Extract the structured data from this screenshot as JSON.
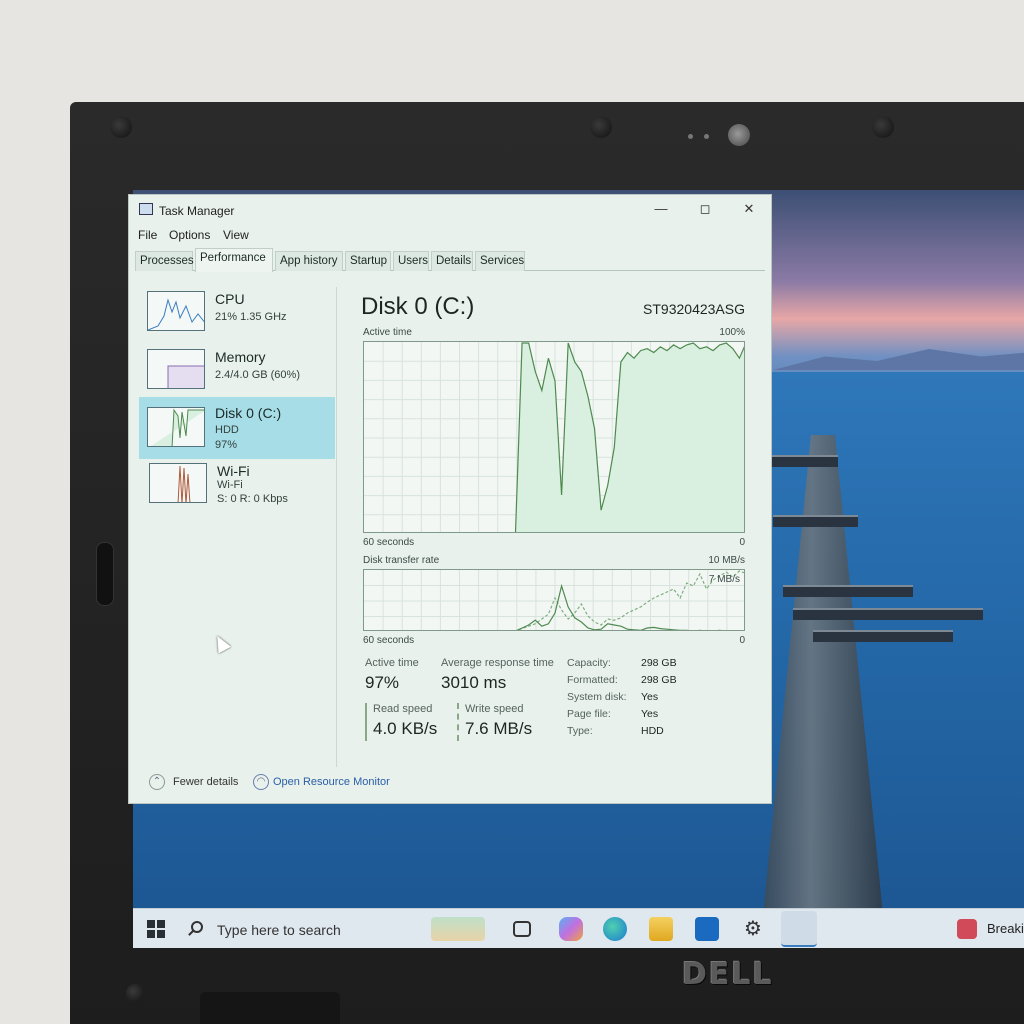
{
  "window": {
    "title": "Task Manager"
  },
  "menu": [
    "File",
    "Options",
    "View"
  ],
  "tabs": [
    "Processes",
    "Performance",
    "App history",
    "Startup",
    "Users",
    "Details",
    "Services"
  ],
  "active_tab": "Performance",
  "sidebar": [
    {
      "name": "CPU",
      "line1": "21%  1.35 GHz",
      "line2": ""
    },
    {
      "name": "Memory",
      "line1": "2.4/4.0 GB (60%)",
      "line2": ""
    },
    {
      "name": "Disk 0 (C:)",
      "line1": "HDD",
      "line2": "97%"
    },
    {
      "name": "Wi-Fi",
      "line1": "Wi-Fi",
      "line2": "S: 0  R: 0 Kbps"
    }
  ],
  "disk": {
    "title": "Disk 0 (C:)",
    "model": "ST9320423ASG",
    "active_label": "Active time",
    "active_max": "100%",
    "axis_left": "60 seconds",
    "axis_right": "0",
    "transfer_label": "Disk transfer rate",
    "transfer_max": "10 MB/s",
    "transfer_mid": "7 MB/s",
    "axis2_left": "60 seconds",
    "axis2_right": "0",
    "active_time_series": [
      0,
      0,
      0,
      0,
      0,
      0,
      0,
      0,
      0,
      0,
      0,
      0,
      0,
      0,
      0,
      0,
      0,
      0,
      0,
      0,
      0,
      0,
      0,
      0,
      100,
      100,
      85,
      75,
      92,
      80,
      20,
      100,
      90,
      85,
      72,
      55,
      12,
      25,
      45,
      90,
      95,
      92,
      96,
      97,
      95,
      98,
      96,
      99,
      97,
      99,
      100,
      97,
      98,
      96,
      99,
      100,
      97,
      92,
      100
    ],
    "transfer_series_read": [
      0,
      0,
      0,
      0,
      0,
      0,
      0,
      0,
      0,
      0,
      0,
      0,
      0,
      0,
      0,
      0,
      0,
      0,
      0,
      0,
      0,
      0,
      0,
      0,
      5,
      10,
      18,
      8,
      12,
      30,
      75,
      40,
      22,
      15,
      5,
      2,
      3,
      12,
      10,
      8,
      3,
      2,
      1,
      5,
      6,
      4,
      3,
      2,
      1,
      1,
      0,
      1,
      0,
      0,
      1,
      0,
      0,
      0,
      0
    ],
    "transfer_series_write": [
      0,
      0,
      0,
      0,
      0,
      0,
      0,
      0,
      0,
      0,
      0,
      0,
      0,
      0,
      0,
      0,
      0,
      0,
      0,
      0,
      0,
      0,
      0,
      0,
      4,
      8,
      12,
      20,
      28,
      55,
      35,
      20,
      30,
      45,
      25,
      15,
      10,
      20,
      18,
      22,
      30,
      35,
      40,
      48,
      55,
      60,
      65,
      70,
      55,
      80,
      75,
      95,
      70,
      85,
      92,
      98,
      90,
      100,
      96
    ]
  },
  "stats": {
    "active_time_label": "Active time",
    "active_time_value": "97%",
    "avg_response_label": "Average response time",
    "avg_response_value": "3010 ms",
    "read_label": "Read speed",
    "read_value": "4.0 KB/s",
    "write_label": "Write speed",
    "write_value": "7.6 MB/s"
  },
  "info": [
    {
      "k": "Capacity:",
      "v": "298 GB"
    },
    {
      "k": "Formatted:",
      "v": "298 GB"
    },
    {
      "k": "System disk:",
      "v": "Yes"
    },
    {
      "k": "Page file:",
      "v": "Yes"
    },
    {
      "k": "Type:",
      "v": "HDD"
    }
  ],
  "footer": {
    "fewer": "Fewer details",
    "resmon": "Open Resource Monitor"
  },
  "taskbar": {
    "search_placeholder": "Type here to search",
    "news": "Breaki"
  },
  "brand": "DELL",
  "colors": {
    "selection": "#a6dde6",
    "graph_line": "#4f8a4f",
    "link": "#2a5fa8",
    "window_bg": "#e8f1ec"
  }
}
